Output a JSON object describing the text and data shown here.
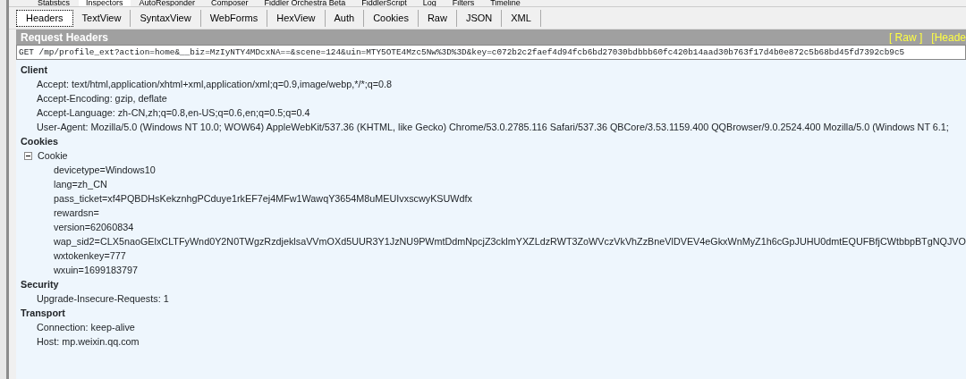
{
  "main_tabs": [
    {
      "label": "Statistics",
      "selected": false
    },
    {
      "label": "Inspectors",
      "selected": true
    },
    {
      "label": "AutoResponder",
      "selected": false
    },
    {
      "label": "Composer",
      "selected": false
    },
    {
      "label": "Fiddler Orchestra Beta",
      "selected": false
    },
    {
      "label": "FiddlerScript",
      "selected": false
    },
    {
      "label": "Log",
      "selected": false
    },
    {
      "label": "Filters",
      "selected": false
    },
    {
      "label": "Timeline",
      "selected": false
    }
  ],
  "inspector_tabs": [
    {
      "label": "Headers",
      "selected": true
    },
    {
      "label": "TextView",
      "selected": false
    },
    {
      "label": "SyntaxView",
      "selected": false
    },
    {
      "label": "WebForms",
      "selected": false
    },
    {
      "label": "HexView",
      "selected": false
    },
    {
      "label": "Auth",
      "selected": false
    },
    {
      "label": "Cookies",
      "selected": false
    },
    {
      "label": "Raw",
      "selected": false
    },
    {
      "label": "JSON",
      "selected": false
    },
    {
      "label": "XML",
      "selected": false
    }
  ],
  "panel": {
    "title": "Request Headers",
    "links": [
      "[ Raw ]",
      "[Heade"
    ]
  },
  "request_line": "GET /mp/profile_ext?action=home&__biz=MzIyNTY4MDcxNA==&scene=124&uin=MTY5OTE4Mzc5Nw%3D%3D&key=c072b2c2faef4d94fcb6bd27030bdbbb60fc420b14aad30b763f17d4b0e872c5b68bd45fd7392cb9c5",
  "tree": [
    {
      "label": "Client",
      "children": [
        {
          "label": "Accept: text/html,application/xhtml+xml,application/xml;q=0.9,image/webp,*/*;q=0.8"
        },
        {
          "label": "Accept-Encoding: gzip, deflate"
        },
        {
          "label": "Accept-Language: zh-CN,zh;q=0.8,en-US;q=0.6,en;q=0.5;q=0.4"
        },
        {
          "label": "User-Agent: Mozilla/5.0 (Windows NT 10.0; WOW64) AppleWebKit/537.36 (KHTML, like Gecko) Chrome/53.0.2785.116 Safari/537.36 QBCore/3.53.1159.400 QQBrowser/9.0.2524.400 Mozilla/5.0 (Windows NT 6.1;"
        }
      ]
    },
    {
      "label": "Cookies",
      "children": [
        {
          "label": "Cookie",
          "expanded": true,
          "children": [
            {
              "label": "devicetype=Windows10"
            },
            {
              "label": "lang=zh_CN"
            },
            {
              "label": "pass_ticket=xf4PQBDHsKekznhgPCduye1rkEF7ej4MFw1WawqY3654M8uMEUIvxscwyKSUWdfx"
            },
            {
              "label": "rewardsn="
            },
            {
              "label": "version=62060834"
            },
            {
              "label": "wap_sid2=CLX5naoGElxCLTFyWnd0Y2N0TWgzRzdjeklsaVVmOXd5UUR3Y1JzNU9PWmtDdmNpcjZ3cklmYXZLdzRWT3ZoWVczVkVhZzBneVlDVEV4eGkxWnMyZ1h6cGpJUHU0dmtEQUFBfjCWtbbpBTgNQJVO"
            },
            {
              "label": "wxtokenkey=777"
            },
            {
              "label": "wxuin=1699183797"
            }
          ]
        }
      ]
    },
    {
      "label": "Security",
      "children": [
        {
          "label": "Upgrade-Insecure-Requests: 1"
        }
      ]
    },
    {
      "label": "Transport",
      "children": [
        {
          "label": "Connection: keep-alive"
        },
        {
          "label": "Host: mp.weixin.qq.com"
        }
      ]
    }
  ]
}
